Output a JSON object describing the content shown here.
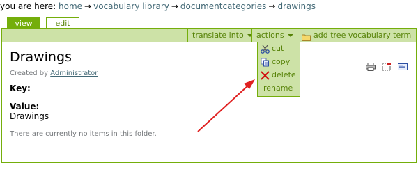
{
  "breadcrumb": {
    "prefix": "you are here:",
    "separator": "→",
    "items": [
      "home",
      "vocabulary library",
      "documentcategories",
      "drawings"
    ]
  },
  "tabs": [
    {
      "label": "view",
      "selected": true
    },
    {
      "label": "edit",
      "selected": false
    }
  ],
  "actionbar": {
    "translate_label": "translate into",
    "actions_label": "actions",
    "add_label": "add tree vocabulary term"
  },
  "actions_menu": [
    {
      "label": "cut",
      "icon": "scissors-icon"
    },
    {
      "label": "copy",
      "icon": "copy-icon"
    },
    {
      "label": "delete",
      "icon": "delete-x-icon"
    },
    {
      "label": "rename",
      "icon": ""
    }
  ],
  "document": {
    "title": "Drawings",
    "created_by_prefix": "Created by",
    "author": "Administrator",
    "key_label": "Key:",
    "value_label": "Value:",
    "value": "Drawings",
    "empty_message": "There are currently no items in this folder."
  },
  "colors": {
    "accent": "#74ae0b",
    "bar_bg": "#cde2a7",
    "link": "#436976",
    "arrow": "#e02020"
  }
}
